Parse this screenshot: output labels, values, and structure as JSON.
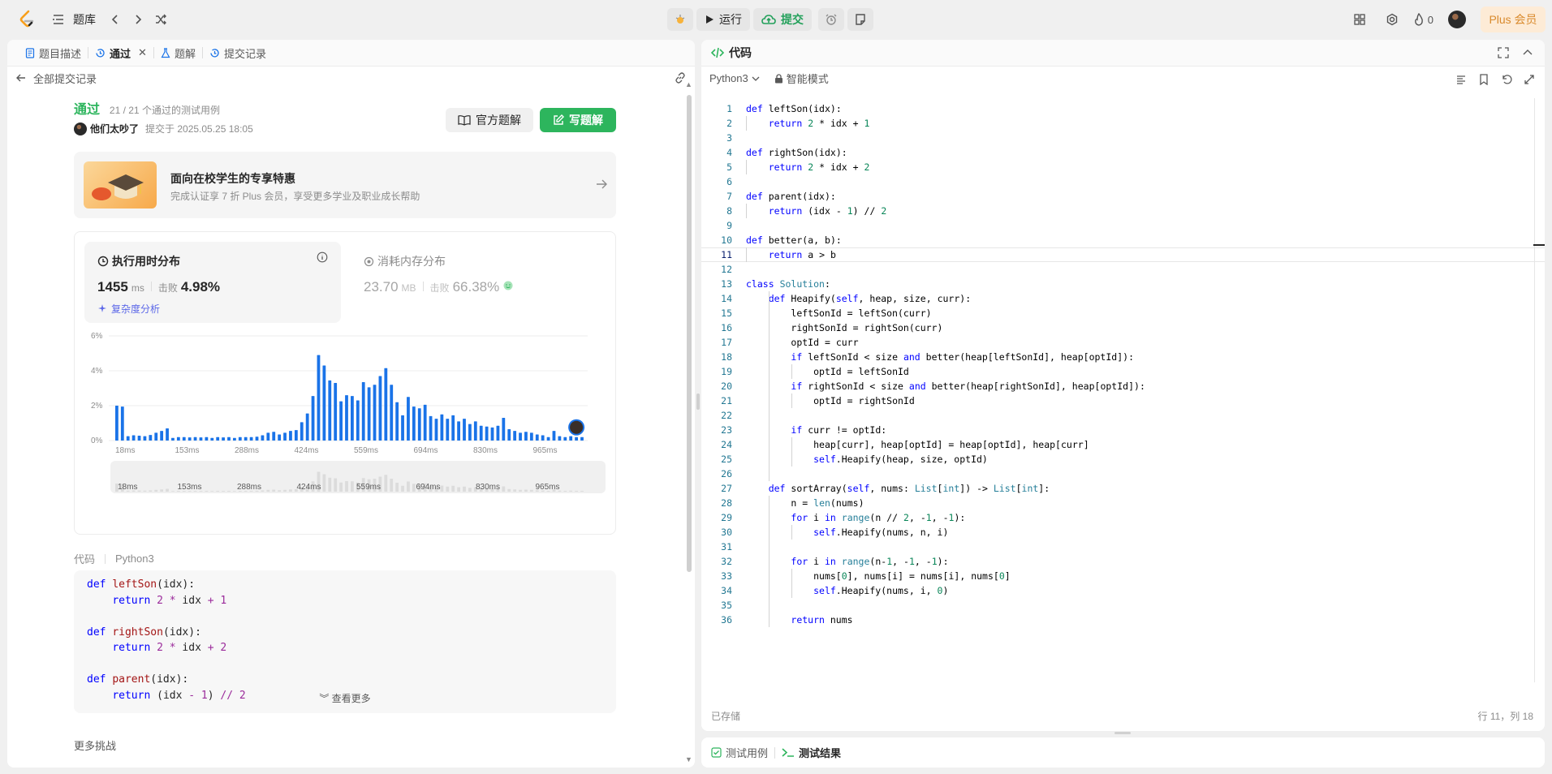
{
  "topbar": {
    "problem_bank": "题库",
    "run": "运行",
    "submit": "提交",
    "fire_count": "0",
    "plus": "Plus 会员"
  },
  "left_tabs": [
    {
      "label": "题目描述",
      "icon": "description-icon"
    },
    {
      "label": "通过",
      "icon": "history-icon",
      "active": true
    },
    {
      "label": "题解",
      "icon": "flask-icon"
    },
    {
      "label": "提交记录",
      "icon": "history-icon"
    }
  ],
  "submission": {
    "back_label": "全部提交记录",
    "status": "通过",
    "testcases": "21 / 21 个通过的测试用例",
    "username": "他们太吵了",
    "submitted_at": "提交于 2025.05.25 18:05",
    "official_solution": "官方题解",
    "write_solution": "写题解"
  },
  "promo": {
    "title": "面向在校学生的专享特惠",
    "subtitle": "完成认证享 7 折 Plus 会员，享受更多学业及职业成长帮助"
  },
  "runtime": {
    "title": "执行用时分布",
    "value": "1455",
    "unit": "ms",
    "beats_label": "击败",
    "beats": "4.98%",
    "complexity": "复杂度分析"
  },
  "memory": {
    "title": "消耗内存分布",
    "value": "23.70",
    "unit": "MB",
    "beats_label": "击败",
    "beats": "66.38%"
  },
  "chart_data": {
    "type": "bar",
    "ylabel_ticks": [
      "0%",
      "2%",
      "4%",
      "6%"
    ],
    "ylim": [
      0,
      6
    ],
    "xticks": [
      "18ms",
      "153ms",
      "288ms",
      "424ms",
      "559ms",
      "694ms",
      "830ms",
      "965ms"
    ],
    "values": [
      2.0,
      1.95,
      0.25,
      0.3,
      0.28,
      0.25,
      0.32,
      0.45,
      0.55,
      0.7,
      0.15,
      0.2,
      0.2,
      0.18,
      0.2,
      0.18,
      0.2,
      0.15,
      0.2,
      0.18,
      0.2,
      0.15,
      0.2,
      0.2,
      0.2,
      0.22,
      0.3,
      0.45,
      0.5,
      0.35,
      0.45,
      0.55,
      0.6,
      1.05,
      1.55,
      2.55,
      4.9,
      4.3,
      3.45,
      3.3,
      2.25,
      2.6,
      2.55,
      2.3,
      3.35,
      3.05,
      3.2,
      3.7,
      4.15,
      3.2,
      2.2,
      1.45,
      2.5,
      1.95,
      1.85,
      2.05,
      1.4,
      1.25,
      1.5,
      1.25,
      1.45,
      1.1,
      1.25,
      0.95,
      1.1,
      0.85,
      0.8,
      0.75,
      0.85,
      1.3,
      0.65,
      0.55,
      0.45,
      0.5,
      0.45,
      0.35,
      0.3,
      0.2,
      0.55,
      0.25,
      0.2,
      0.25,
      0.2,
      0.2
    ],
    "highlight_index": 82
  },
  "code_section": {
    "label": "代码",
    "lang": "Python3",
    "show_more": "查看更多",
    "more_challenges": "更多挑战"
  },
  "preview_lines": [
    "def leftSon(idx):",
    "    return 2 * idx + 1",
    "",
    "def rightSon(idx):",
    "    return 2 * idx + 2",
    "",
    "def parent(idx):",
    "    return (idx - 1) // 2"
  ],
  "editor": {
    "title": "代码",
    "language": "Python3",
    "mode": "智能模式",
    "saved": "已存储",
    "cursor": "行 11，列 18",
    "current_line": 11
  },
  "code_lines": [
    "def leftSon(idx):",
    "    return 2 * idx + 1",
    "",
    "def rightSon(idx):",
    "    return 2 * idx + 2",
    "",
    "def parent(idx):",
    "    return (idx - 1) // 2",
    "",
    "def better(a, b):",
    "    return a > b",
    "",
    "class Solution:",
    "    def Heapify(self, heap, size, curr):",
    "        leftSonId = leftSon(curr)",
    "        rightSonId = rightSon(curr)",
    "        optId = curr",
    "        if leftSonId < size and better(heap[leftSonId], heap[optId]):",
    "            optId = leftSonId",
    "        if rightSonId < size and better(heap[rightSonId], heap[optId]):",
    "            optId = rightSonId",
    "",
    "        if curr != optId:",
    "            heap[curr], heap[optId] = heap[optId], heap[curr]",
    "            self.Heapify(heap, size, optId)",
    "",
    "    def sortArray(self, nums: List[int]) -> List[int]:",
    "        n = len(nums)",
    "        for i in range(n // 2, -1, -1):",
    "            self.Heapify(nums, n, i)",
    "",
    "        for i in range(n-1, -1, -1):",
    "            nums[0], nums[i] = nums[i], nums[0]",
    "            self.Heapify(nums, i, 0)",
    "",
    "        return nums"
  ],
  "bottom_tabs": [
    {
      "label": "测试用例",
      "icon": "checkbox-icon"
    },
    {
      "label": "测试结果",
      "icon": "terminal-icon",
      "active": true
    }
  ],
  "colors": {
    "accent_green": "#2db55d",
    "bar_blue": "#1a73e8",
    "plus_orange": "#d98a2c"
  }
}
